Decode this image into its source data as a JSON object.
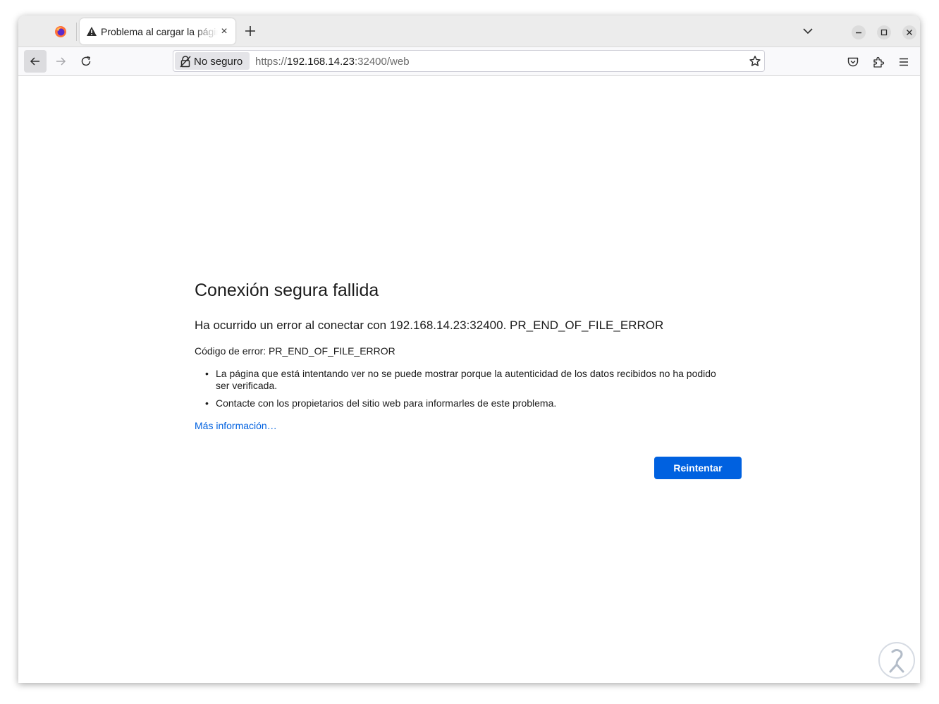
{
  "tab": {
    "title": "Problema al cargar la página",
    "close_glyph": "×"
  },
  "navbar": {
    "identity_label": "No seguro",
    "url_scheme": "https://",
    "url_host": "192.168.14.23",
    "url_rest": ":32400/web"
  },
  "error": {
    "title": "Conexión segura fallida",
    "short_desc": "Ha ocurrido un error al conectar con 192.168.14.23:32400. PR_END_OF_FILE_ERROR",
    "code_line": "Código de error: PR_END_OF_FILE_ERROR",
    "bullets": [
      "La página que está intentando ver no se puede mostrar porque la autenticidad de los datos recibidos no ha podido ser verificada.",
      "Contacte con los propietarios del sitio web para informarles de este problema."
    ],
    "more_info": "Más información…",
    "retry_label": "Reintentar"
  },
  "icons": {
    "firefox": "firefox-logo-icon",
    "tab_warning": "warning-icon",
    "new_tab": "plus-icon",
    "list_tabs": "chevron-down-icon",
    "minimize": "minimize-icon",
    "maximize": "maximize-icon",
    "close": "close-icon",
    "back": "arrow-left-icon",
    "forward": "arrow-right-icon",
    "reload": "reload-icon",
    "insecure_lock": "insecure-lock-icon",
    "bookmark": "star-icon",
    "pocket": "pocket-icon",
    "extensions": "puzzle-icon",
    "menu": "hamburger-icon"
  },
  "colors": {
    "accent": "#0061e0",
    "link": "#0061e0",
    "text": "#1b1b1b"
  }
}
